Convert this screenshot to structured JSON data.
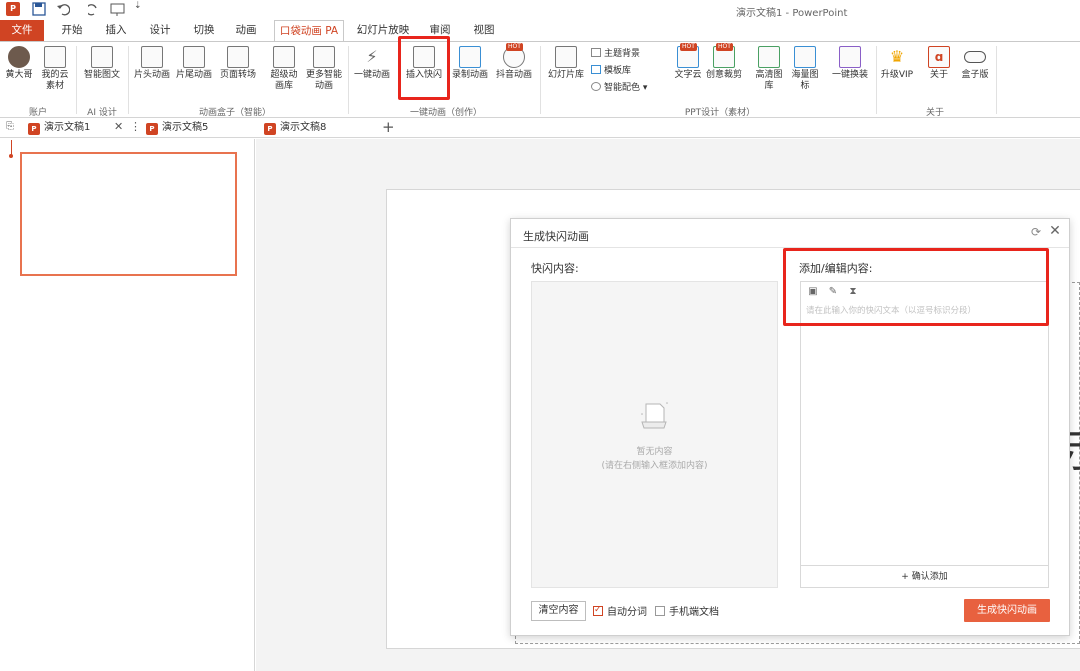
{
  "titlebar": {
    "doc_title": "演示文稿1 - PowerPoint"
  },
  "tabs": [
    {
      "label": "文件"
    },
    {
      "label": "开始"
    },
    {
      "label": "插入"
    },
    {
      "label": "设计"
    },
    {
      "label": "切换"
    },
    {
      "label": "动画"
    },
    {
      "label": "口袋动画 PA"
    },
    {
      "label": "幻灯片放映"
    },
    {
      "label": "审阅"
    },
    {
      "label": "视图"
    }
  ],
  "ribbon": {
    "buttons": {
      "huangdage": "黄大哥",
      "my_material": "我的云素材",
      "smart_graphic": "智能图文",
      "title_anim": "片头动画",
      "end_anim": "片尾动画",
      "page_transition": "页面转场",
      "super_anim_lib": "超级动画库",
      "more_smart_anim": "更多智能动画",
      "one_click_anim": "一键动画",
      "insert_flash": "插入快闪",
      "record_anim": "录制动画",
      "douyin_anim": "抖音动画",
      "slide_lib": "幻灯片库",
      "theme_bg": "主题背景",
      "template_lib": "模板库",
      "smart_color": "智能配色",
      "word_cloud": "文字云",
      "creative_crop": "创意裁剪",
      "hd_image_lib": "高清图库",
      "mass_icons": "海量图标",
      "one_click_replace": "一键换装",
      "upgrade_vip": "升级VIP",
      "about": "关于",
      "box_edition": "盒子版"
    },
    "groups": {
      "account": "账户",
      "ai_design": "AI 设计",
      "anim_box": "动画盒子（智能）",
      "one_click_create": "一键动画（创作）",
      "ppt_design": "PPT设计（素材）",
      "about": "关于"
    }
  },
  "doctabs": [
    {
      "label": "演示文稿1"
    },
    {
      "label": "演示文稿5"
    },
    {
      "label": "演示文稿8"
    }
  ],
  "dialog": {
    "title": "生成快闪动画",
    "left_label": "快闪内容:",
    "right_label": "添加/编辑内容:",
    "empty_title": "暂无内容",
    "empty_sub": "(请在右侧输入框添加内容)",
    "placeholder": "请在此输入你的快闪文本（以逗号标识分段）",
    "confirm_add": "+ 确认添加",
    "clear_btn": "清空内容",
    "auto_split": "自动分词",
    "auto_split_checked": true,
    "phone_doc": "手机端文档",
    "phone_doc_checked": false,
    "generate_btn": "生成快闪动画"
  },
  "slide": {
    "visible_glyph": "示"
  },
  "colors": {
    "accent": "#d04423",
    "highlight": "#e8251c",
    "generate": "#e8613f"
  }
}
